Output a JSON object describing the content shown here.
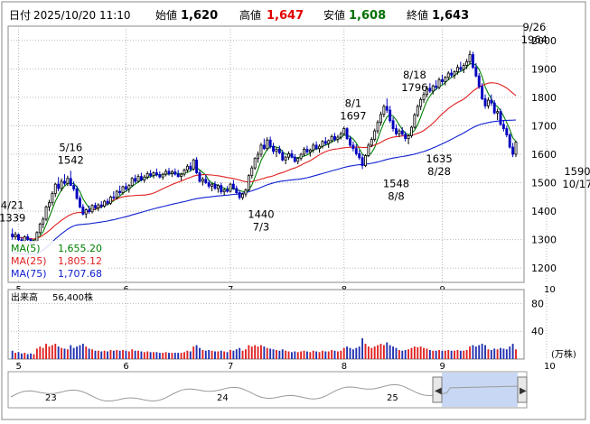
{
  "header": {
    "date_label": "日付",
    "datetime": "2025/10/20 11:10",
    "open_label": "始値",
    "open": "1,620",
    "high_label": "高値",
    "high": "1,647",
    "low_label": "安値",
    "low": "1,608",
    "close_label": "終値",
    "close": "1,643"
  },
  "colors": {
    "up": "#ff0000",
    "down": "#0000c0",
    "high": "#ff0000",
    "low": "#007000",
    "ma5": "#008000",
    "ma25": "#e02020",
    "ma75": "#1020d0",
    "vol_up": "#e02020",
    "vol_down": "#2030b0",
    "grid": "#b8b8b8"
  },
  "ma_legend": [
    {
      "name": "MA(5)",
      "value": "1,655.20",
      "color": "#008000"
    },
    {
      "name": "MA(25)",
      "value": "1,805.12",
      "color": "#e02020"
    },
    {
      "name": "MA(75)",
      "value": "1,707.68",
      "color": "#1020d0"
    }
  ],
  "volume": {
    "label": "出来高",
    "value": "56,400株",
    "unit": "(万株)"
  },
  "navigator": {
    "labels": [
      "23",
      "24",
      "25"
    ]
  },
  "chart_data": {
    "type": "candlestick",
    "price_axis": {
      "ticks": [
        1200,
        1300,
        1400,
        1500,
        1600,
        1700,
        1800,
        1900,
        2000
      ],
      "range": [
        1150,
        2050
      ]
    },
    "volume_axis": {
      "ticks": [
        40,
        80
      ],
      "range": [
        0,
        100
      ]
    },
    "month_labels": [
      {
        "label": "5",
        "index": 2
      },
      {
        "label": "6",
        "index": 37
      },
      {
        "label": "7",
        "index": 71
      },
      {
        "label": "8",
        "index": 108
      },
      {
        "label": "9",
        "index": 140
      },
      {
        "label": "10",
        "index": 174
      }
    ],
    "annotations": [
      {
        "date": "4/21",
        "price": "1339",
        "index": 0,
        "value": 1339,
        "position": "above"
      },
      {
        "date": "5/16",
        "price": "1542",
        "index": 19,
        "value": 1542,
        "position": "above"
      },
      {
        "date": "7/3",
        "price": "1440",
        "index": 81,
        "value": 1440,
        "position": "below"
      },
      {
        "date": "8/1",
        "price": "1697",
        "index": 111,
        "value": 1697,
        "position": "above"
      },
      {
        "date": "8/8",
        "price": "1548",
        "index": 125,
        "value": 1548,
        "position": "below"
      },
      {
        "date": "8/18",
        "price": "1796",
        "index": 131,
        "value": 1796,
        "position": "above"
      },
      {
        "date": "8/28",
        "price": "1635",
        "index": 139,
        "value": 1635,
        "position": "below"
      },
      {
        "date": "9/26",
        "price": "1964",
        "index": 170,
        "value": 1964,
        "position": "above"
      },
      {
        "date": "10/17",
        "price": "1590",
        "index": 184,
        "value": 1590,
        "position": "below"
      }
    ],
    "candles": [
      [
        1320,
        1339,
        1300,
        1310,
        12
      ],
      [
        1310,
        1328,
        1300,
        1318,
        9
      ],
      [
        1318,
        1322,
        1290,
        1300,
        10
      ],
      [
        1300,
        1310,
        1285,
        1295,
        8
      ],
      [
        1295,
        1315,
        1290,
        1310,
        9
      ],
      [
        1310,
        1320,
        1295,
        1300,
        7
      ],
      [
        1300,
        1305,
        1280,
        1290,
        8
      ],
      [
        1290,
        1300,
        1280,
        1295,
        7
      ],
      [
        1295,
        1330,
        1290,
        1325,
        15
      ],
      [
        1325,
        1360,
        1318,
        1355,
        18
      ],
      [
        1355,
        1380,
        1340,
        1372,
        16
      ],
      [
        1372,
        1420,
        1365,
        1415,
        22
      ],
      [
        1415,
        1440,
        1400,
        1430,
        18
      ],
      [
        1430,
        1470,
        1420,
        1462,
        20
      ],
      [
        1462,
        1500,
        1450,
        1495,
        22
      ],
      [
        1495,
        1520,
        1470,
        1480,
        18
      ],
      [
        1480,
        1515,
        1470,
        1505,
        16
      ],
      [
        1505,
        1530,
        1490,
        1498,
        15
      ],
      [
        1498,
        1525,
        1488,
        1515,
        14
      ],
      [
        1515,
        1542,
        1500,
        1490,
        20
      ],
      [
        1490,
        1505,
        1470,
        1478,
        16
      ],
      [
        1478,
        1490,
        1440,
        1445,
        18
      ],
      [
        1445,
        1455,
        1410,
        1415,
        20
      ],
      [
        1415,
        1425,
        1385,
        1390,
        22
      ],
      [
        1390,
        1410,
        1375,
        1405,
        18
      ],
      [
        1405,
        1420,
        1390,
        1398,
        15
      ],
      [
        1398,
        1425,
        1392,
        1420,
        14
      ],
      [
        1420,
        1430,
        1405,
        1412,
        12
      ],
      [
        1412,
        1428,
        1400,
        1422,
        12
      ],
      [
        1422,
        1435,
        1410,
        1418,
        11
      ],
      [
        1418,
        1440,
        1412,
        1435,
        12
      ],
      [
        1435,
        1445,
        1420,
        1428,
        11
      ],
      [
        1428,
        1455,
        1422,
        1450,
        13
      ],
      [
        1450,
        1470,
        1440,
        1448,
        12
      ],
      [
        1448,
        1475,
        1440,
        1470,
        13
      ],
      [
        1470,
        1490,
        1455,
        1465,
        12
      ],
      [
        1465,
        1490,
        1458,
        1486,
        13
      ],
      [
        1486,
        1500,
        1470,
        1478,
        12
      ],
      [
        1478,
        1495,
        1465,
        1490,
        11
      ],
      [
        1490,
        1520,
        1485,
        1515,
        14
      ],
      [
        1515,
        1528,
        1498,
        1505,
        12
      ],
      [
        1505,
        1530,
        1500,
        1522,
        12
      ],
      [
        1522,
        1535,
        1505,
        1510,
        11
      ],
      [
        1510,
        1528,
        1500,
        1520,
        10
      ],
      [
        1520,
        1540,
        1512,
        1532,
        11
      ],
      [
        1532,
        1545,
        1518,
        1525,
        10
      ],
      [
        1525,
        1540,
        1515,
        1535,
        10
      ],
      [
        1535,
        1550,
        1522,
        1528,
        10
      ],
      [
        1528,
        1540,
        1515,
        1520,
        9
      ],
      [
        1520,
        1535,
        1510,
        1530,
        9
      ],
      [
        1530,
        1548,
        1522,
        1540,
        10
      ],
      [
        1540,
        1552,
        1525,
        1532,
        9
      ],
      [
        1532,
        1545,
        1520,
        1538,
        9
      ],
      [
        1538,
        1550,
        1525,
        1530,
        9
      ],
      [
        1530,
        1545,
        1518,
        1522,
        9
      ],
      [
        1522,
        1535,
        1508,
        1530,
        9
      ],
      [
        1530,
        1550,
        1522,
        1545,
        10
      ],
      [
        1545,
        1565,
        1535,
        1558,
        12
      ],
      [
        1558,
        1572,
        1540,
        1548,
        11
      ],
      [
        1548,
        1585,
        1542,
        1580,
        18
      ],
      [
        1580,
        1590,
        1530,
        1535,
        20
      ],
      [
        1535,
        1545,
        1500,
        1505,
        16
      ],
      [
        1505,
        1520,
        1490,
        1512,
        13
      ],
      [
        1512,
        1528,
        1495,
        1500,
        12
      ],
      [
        1500,
        1510,
        1480,
        1488,
        13
      ],
      [
        1488,
        1500,
        1470,
        1495,
        12
      ],
      [
        1495,
        1505,
        1475,
        1480,
        11
      ],
      [
        1480,
        1495,
        1465,
        1490,
        11
      ],
      [
        1490,
        1500,
        1460,
        1468,
        12
      ],
      [
        1468,
        1480,
        1455,
        1475,
        11
      ],
      [
        1475,
        1488,
        1465,
        1470,
        10
      ],
      [
        1470,
        1500,
        1465,
        1495,
        13
      ],
      [
        1495,
        1510,
        1475,
        1480,
        12
      ],
      [
        1480,
        1490,
        1460,
        1465,
        14
      ],
      [
        1465,
        1475,
        1440,
        1448,
        16
      ],
      [
        1448,
        1465,
        1440,
        1460,
        12
      ],
      [
        1460,
        1480,
        1450,
        1475,
        14
      ],
      [
        1475,
        1530,
        1470,
        1525,
        20
      ],
      [
        1525,
        1560,
        1515,
        1552,
        18
      ],
      [
        1552,
        1590,
        1545,
        1585,
        20
      ],
      [
        1585,
        1610,
        1570,
        1600,
        18
      ],
      [
        1600,
        1640,
        1590,
        1632,
        20
      ],
      [
        1632,
        1655,
        1615,
        1620,
        18
      ],
      [
        1620,
        1660,
        1612,
        1650,
        16
      ],
      [
        1650,
        1662,
        1620,
        1628,
        15
      ],
      [
        1628,
        1640,
        1600,
        1610,
        14
      ],
      [
        1610,
        1625,
        1590,
        1618,
        13
      ],
      [
        1618,
        1630,
        1600,
        1605,
        12
      ],
      [
        1605,
        1615,
        1575,
        1580,
        14
      ],
      [
        1580,
        1595,
        1565,
        1590,
        12
      ],
      [
        1590,
        1610,
        1580,
        1602,
        11
      ],
      [
        1602,
        1615,
        1585,
        1590,
        10
      ],
      [
        1590,
        1600,
        1570,
        1575,
        11
      ],
      [
        1575,
        1590,
        1565,
        1585,
        10
      ],
      [
        1585,
        1605,
        1578,
        1600,
        11
      ],
      [
        1600,
        1625,
        1592,
        1618,
        12
      ],
      [
        1618,
        1630,
        1600,
        1608,
        11
      ],
      [
        1608,
        1620,
        1592,
        1615,
        10
      ],
      [
        1615,
        1640,
        1605,
        1632,
        12
      ],
      [
        1632,
        1645,
        1615,
        1620,
        11
      ],
      [
        1620,
        1635,
        1605,
        1628,
        10
      ],
      [
        1628,
        1650,
        1620,
        1645,
        12
      ],
      [
        1645,
        1660,
        1630,
        1638,
        11
      ],
      [
        1638,
        1652,
        1622,
        1648,
        11
      ],
      [
        1648,
        1670,
        1640,
        1662,
        13
      ],
      [
        1662,
        1675,
        1645,
        1652,
        12
      ],
      [
        1652,
        1668,
        1640,
        1660,
        11
      ],
      [
        1660,
        1680,
        1652,
        1672,
        12
      ],
      [
        1672,
        1697,
        1665,
        1690,
        16
      ],
      [
        1690,
        1695,
        1650,
        1655,
        18
      ],
      [
        1655,
        1665,
        1625,
        1632,
        16
      ],
      [
        1632,
        1645,
        1610,
        1620,
        14
      ],
      [
        1620,
        1635,
        1595,
        1602,
        16
      ],
      [
        1602,
        1615,
        1580,
        1588,
        18
      ],
      [
        1588,
        1600,
        1548,
        1560,
        30
      ],
      [
        1560,
        1600,
        1555,
        1595,
        22
      ],
      [
        1595,
        1640,
        1590,
        1632,
        18
      ],
      [
        1632,
        1660,
        1625,
        1652,
        16
      ],
      [
        1652,
        1690,
        1645,
        1682,
        18
      ],
      [
        1682,
        1720,
        1672,
        1712,
        20
      ],
      [
        1712,
        1750,
        1700,
        1740,
        22
      ],
      [
        1740,
        1775,
        1730,
        1768,
        20
      ],
      [
        1768,
        1796,
        1745,
        1755,
        24
      ],
      [
        1755,
        1770,
        1710,
        1718,
        20
      ],
      [
        1718,
        1730,
        1680,
        1690,
        18
      ],
      [
        1690,
        1705,
        1665,
        1672,
        16
      ],
      [
        1672,
        1690,
        1660,
        1682,
        13
      ],
      [
        1682,
        1695,
        1665,
        1670,
        12
      ],
      [
        1670,
        1680,
        1645,
        1655,
        13
      ],
      [
        1655,
        1670,
        1635,
        1665,
        14
      ],
      [
        1665,
        1700,
        1658,
        1695,
        16
      ],
      [
        1695,
        1745,
        1690,
        1738,
        18
      ],
      [
        1738,
        1775,
        1730,
        1768,
        17
      ],
      [
        1768,
        1800,
        1755,
        1792,
        18
      ],
      [
        1792,
        1820,
        1780,
        1810,
        16
      ],
      [
        1810,
        1840,
        1800,
        1832,
        15
      ],
      [
        1832,
        1850,
        1815,
        1822,
        13
      ],
      [
        1822,
        1845,
        1810,
        1840,
        12
      ],
      [
        1840,
        1860,
        1825,
        1835,
        12
      ],
      [
        1835,
        1870,
        1828,
        1862,
        13
      ],
      [
        1862,
        1880,
        1845,
        1855,
        12
      ],
      [
        1855,
        1875,
        1842,
        1870,
        12
      ],
      [
        1870,
        1892,
        1860,
        1885,
        13
      ],
      [
        1885,
        1900,
        1868,
        1878,
        12
      ],
      [
        1878,
        1895,
        1865,
        1890,
        12
      ],
      [
        1890,
        1915,
        1880,
        1905,
        13
      ],
      [
        1905,
        1925,
        1890,
        1898,
        12
      ],
      [
        1898,
        1920,
        1885,
        1912,
        12
      ],
      [
        1912,
        1935,
        1900,
        1925,
        13
      ],
      [
        1925,
        1964,
        1915,
        1950,
        18
      ],
      [
        1950,
        1960,
        1900,
        1905,
        20
      ],
      [
        1905,
        1920,
        1870,
        1875,
        18
      ],
      [
        1875,
        1885,
        1830,
        1838,
        20
      ],
      [
        1838,
        1850,
        1790,
        1795,
        22
      ],
      [
        1795,
        1810,
        1760,
        1770,
        20
      ],
      [
        1770,
        1800,
        1760,
        1790,
        14
      ],
      [
        1790,
        1810,
        1770,
        1780,
        13
      ],
      [
        1780,
        1790,
        1740,
        1745,
        15
      ],
      [
        1745,
        1760,
        1720,
        1750,
        14
      ],
      [
        1750,
        1760,
        1700,
        1705,
        16
      ],
      [
        1705,
        1720,
        1680,
        1690,
        15
      ],
      [
        1690,
        1700,
        1660,
        1668,
        14
      ],
      [
        1668,
        1675,
        1620,
        1625,
        18
      ],
      [
        1625,
        1640,
        1590,
        1600,
        22
      ],
      [
        1600,
        1647,
        1590,
        1643,
        14
      ]
    ]
  }
}
